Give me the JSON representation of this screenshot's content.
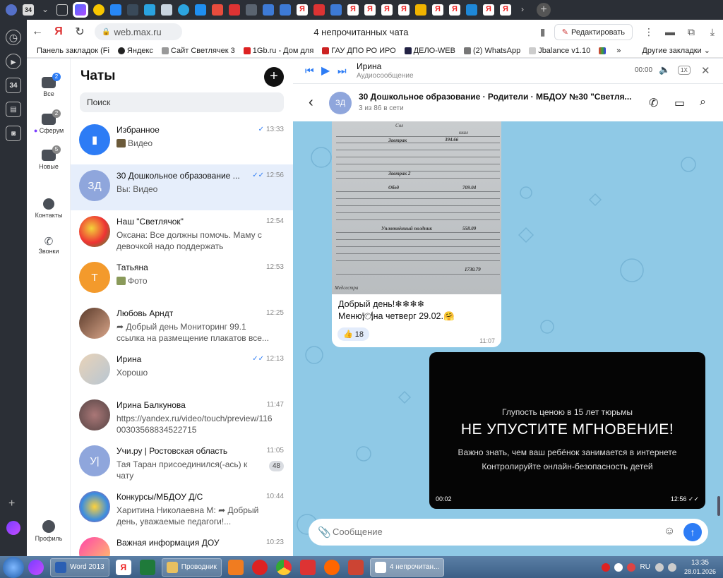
{
  "browser": {
    "url": "web.max.ru",
    "page_title": "4 непрочитанных чата",
    "edit_label": "Редактировать",
    "bookmarks": [
      "Панель закладок (Fi",
      "Яндекс",
      "Сайт Светлячек 3",
      "1Gb.ru - Дом для",
      "ГАУ ДПО РО ИРО",
      "ДЕЛО-WEB",
      "(2) WhatsApp",
      "Jbalance v1.10"
    ],
    "other_bookmarks": "Другие закладки",
    "side_counter": "34"
  },
  "rail": {
    "items": [
      {
        "label": "Все",
        "badge": "2"
      },
      {
        "label": "Сферум",
        "badge": "2"
      },
      {
        "label": "Новые",
        "badge": "5"
      },
      {
        "label": "Контакты"
      },
      {
        "label": "Звонки"
      }
    ],
    "profile": "Профиль"
  },
  "chats": {
    "title": "Чаты",
    "search_placeholder": "Поиск",
    "items": [
      {
        "name": "Избранное",
        "preview": "Видео",
        "time": "13:33",
        "avatar": ""
      },
      {
        "name": "30 Дошкольное образование ...",
        "preview": "Вы:  Видео",
        "time": "12:56",
        "avatar": "ЗД"
      },
      {
        "name": "Наш \"Светлячок\"",
        "preview": "Оксана: Все должны помочь. Маму с девочкой надо поддержать",
        "time": "12:54",
        "avatar": ""
      },
      {
        "name": "Татьяна",
        "preview": "Фото",
        "time": "12:53",
        "avatar": "Т"
      },
      {
        "name": "Любовь Арндт",
        "preview": "➦ Добрый день Мониторинг 99.1 ссылка на размещение плакатов все...",
        "time": "12:25",
        "avatar": ""
      },
      {
        "name": "Ирина",
        "preview": "Хорошо",
        "time": "12:13",
        "avatar": ""
      },
      {
        "name": "Ирина Балкунова",
        "preview": "https://yandex.ru/video/touch/preview/11600303568834522715",
        "time": "11:47",
        "avatar": ""
      },
      {
        "name": "Учи.ру | Ростовская область",
        "preview": "Тая Таран присоединился(-ась) к чату",
        "time": "11:05",
        "avatar": "У|",
        "badge": "48"
      },
      {
        "name": "Конкурсы/МБДОУ Д/С",
        "preview": "Харитина Николаевна М: ➦ Добрый день, уважаемые педагоги!...",
        "time": "10:44",
        "avatar": ""
      },
      {
        "name": "Важная информация ДОУ",
        "preview": "",
        "time": "10:23",
        "avatar": ""
      }
    ]
  },
  "player": {
    "name": "Ирина",
    "subtitle": "Аудиосообщение",
    "time": "00:00",
    "speed": "1X"
  },
  "conversation": {
    "avatar": "ЗД",
    "title": "30 Дошкольное образование · Родители · МБДОУ №30 \"Светля...",
    "subtitle": "3 из 86 в сети"
  },
  "menu_photo": {
    "header": "Сол",
    "cols": "ккал",
    "sec1": "Завтрак",
    "sum1": "394.66",
    "sec2": "Завтрак 2",
    "sec3": "Обед",
    "sum3": "709.04",
    "sec4": "Уплотнённый полдник",
    "sum4": "558.09",
    "total": "1730.79",
    "signature": "Медсестра"
  },
  "message_in": {
    "text_line1": "Добрый день!❄❄❄❄",
    "text_line2": "Меню🍽на четверг 29.02.🤗",
    "reaction": "👍 18",
    "time": "11:07"
  },
  "video": {
    "line1": "Глупость ценою в 15 лет тюрьмы",
    "line2": "НЕ УПУСТИТЕ МГНОВЕНИЕ!",
    "line3": "Важно знать, чем ваш ребёнок занимается в интернете",
    "line4": "Контролируйте онлайн-безопасность детей",
    "duration": "00:02",
    "time": "12:56 ✓✓"
  },
  "composer": {
    "placeholder": "Сообщение"
  },
  "taskbar": {
    "word": "Word 2013",
    "explorer": "Проводник",
    "browser_tab": "4 непрочитан...",
    "lang": "RU",
    "time": "13:35",
    "date": "28.01.2026"
  },
  "colors": {
    "accent": "#2d7cf5",
    "chat_bg": "#8fc9e6"
  }
}
